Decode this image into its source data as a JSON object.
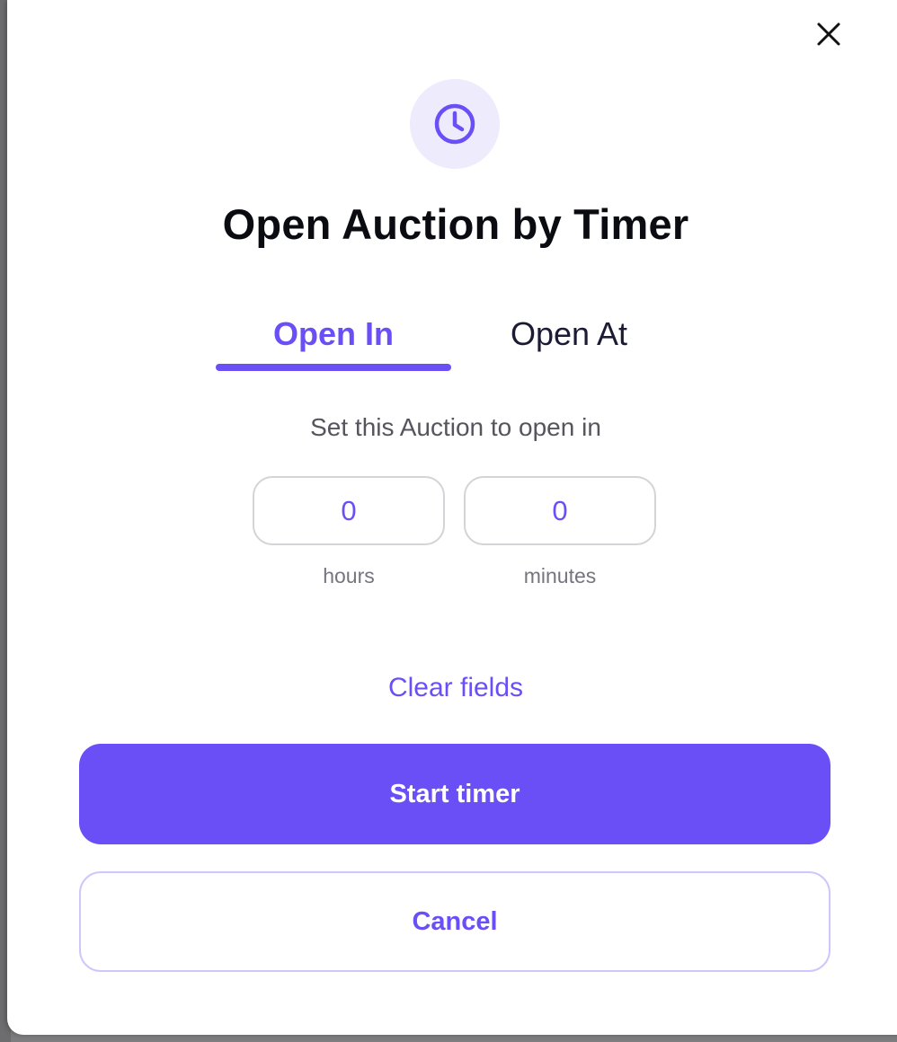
{
  "dialog": {
    "title": "Open Auction by Timer",
    "icon": "clock-icon",
    "close_icon": "close-icon"
  },
  "tabs": [
    {
      "label": "Open In",
      "active": true
    },
    {
      "label": "Open At",
      "active": false
    }
  ],
  "form": {
    "subtitle": "Set this Auction to open in",
    "hours": {
      "value": "0",
      "label": "hours"
    },
    "minutes": {
      "value": "0",
      "label": "minutes"
    },
    "clear_label": "Clear fields"
  },
  "actions": {
    "start_label": "Start timer",
    "cancel_label": "Cancel"
  },
  "colors": {
    "accent": "#6a4ff6",
    "icon_bg": "#eeebfd",
    "title": "#0b0b12",
    "muted": "#55555e"
  }
}
